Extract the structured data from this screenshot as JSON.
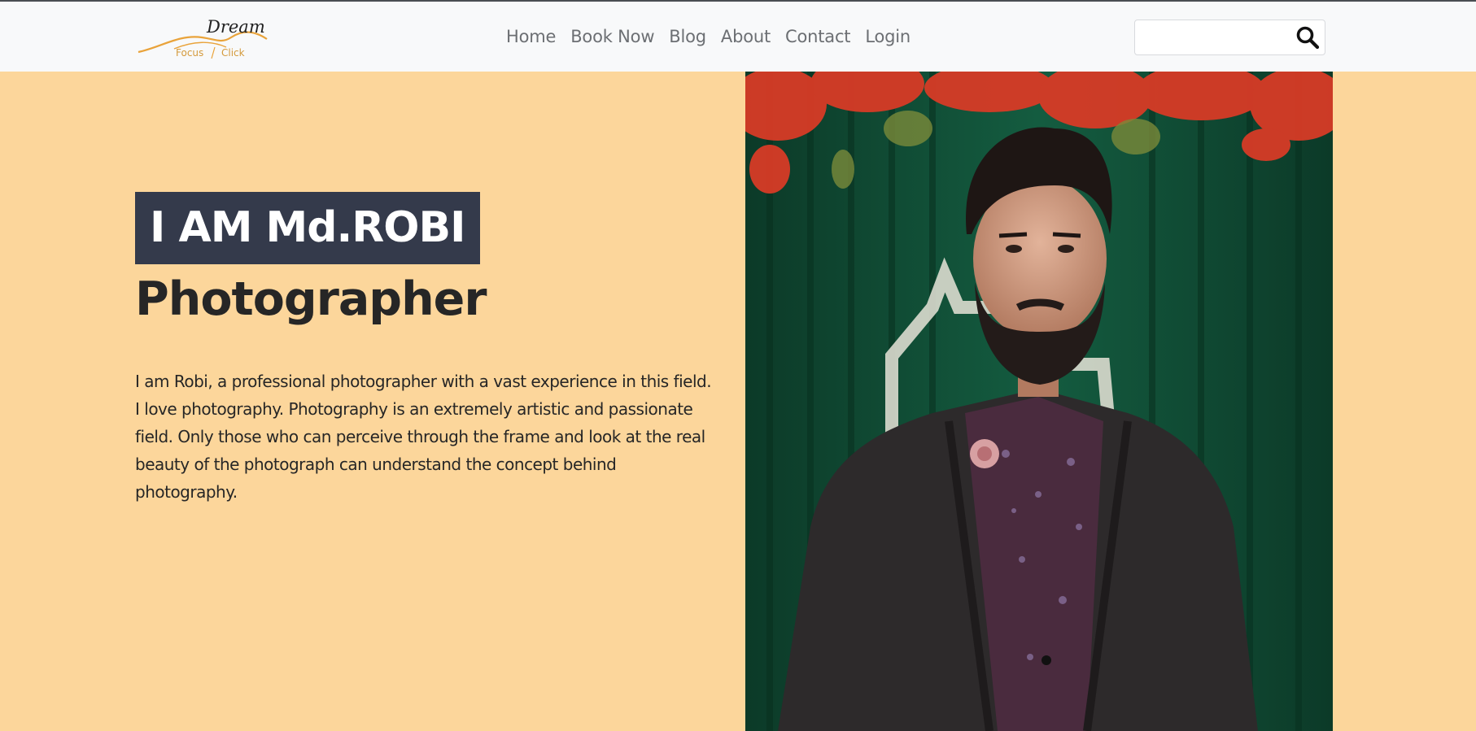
{
  "brand": {
    "logo_script": "Dream",
    "logo_left": "Focus",
    "logo_right": "Click",
    "accent_color": "#e9a33a"
  },
  "nav": {
    "items": [
      {
        "label": "Home"
      },
      {
        "label": "Book Now"
      },
      {
        "label": "Blog"
      },
      {
        "label": "About"
      },
      {
        "label": "Contact"
      },
      {
        "label": "Login"
      }
    ]
  },
  "search": {
    "value": "",
    "placeholder": "",
    "icon": "search-icon"
  },
  "hero": {
    "name": "I AM Md.ROBI",
    "role": "Photographer",
    "bio": "I am Robi, a professional photographer with a vast experience in this field. I love photography. Photography is an extremely artistic and passionate field. Only those who can perceive through the frame and look at the real beauty of the photograph can understand the concept behind photography.",
    "background_color": "#fcd69b",
    "badge_color": "#343a4b"
  },
  "portrait": {
    "subject": "bearded-man-in-dark-blazer-portrait"
  }
}
